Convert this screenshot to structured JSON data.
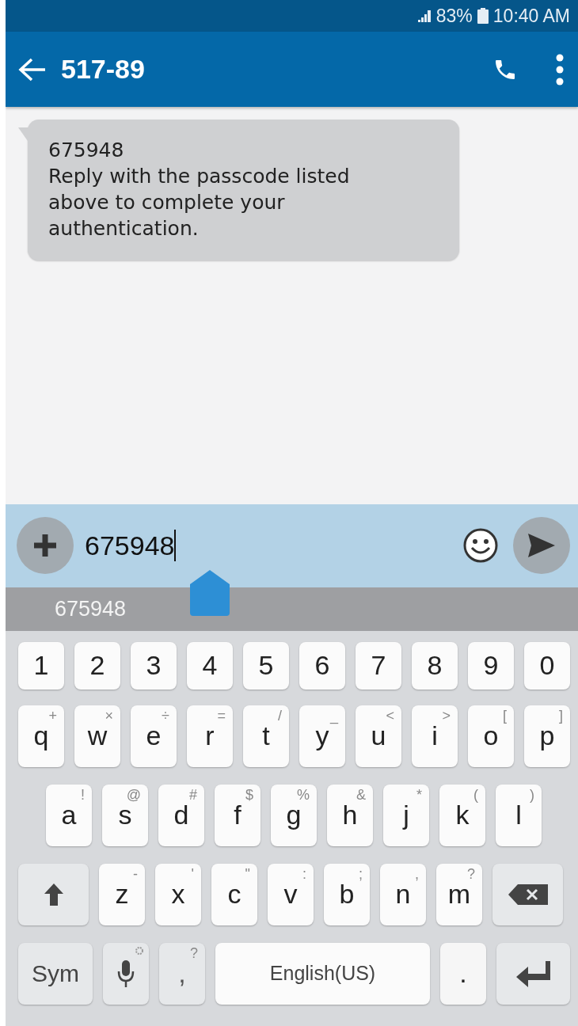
{
  "status_bar": {
    "battery": "83%",
    "time": "10:40 AM"
  },
  "app_bar": {
    "title": "517-89"
  },
  "messages": [
    {
      "code": "675948",
      "text": "Reply with the passcode listed above to complete your authentication."
    }
  ],
  "composer": {
    "value": "675948"
  },
  "suggestions": [
    "675948"
  ],
  "keyboard": {
    "rows": [
      {
        "keys": [
          {
            "kind": "char",
            "label": "1"
          },
          {
            "kind": "char",
            "label": "2"
          },
          {
            "kind": "char",
            "label": "3"
          },
          {
            "kind": "char",
            "label": "4"
          },
          {
            "kind": "char",
            "label": "5"
          },
          {
            "kind": "char",
            "label": "6"
          },
          {
            "kind": "char",
            "label": "7"
          },
          {
            "kind": "char",
            "label": "8"
          },
          {
            "kind": "char",
            "label": "9"
          },
          {
            "kind": "char",
            "label": "0"
          }
        ]
      },
      {
        "keys": [
          {
            "kind": "char",
            "label": "q",
            "hint": "+"
          },
          {
            "kind": "char",
            "label": "w",
            "hint": "×"
          },
          {
            "kind": "char",
            "label": "e",
            "hint": "÷"
          },
          {
            "kind": "char",
            "label": "r",
            "hint": "="
          },
          {
            "kind": "char",
            "label": "t",
            "hint": "/"
          },
          {
            "kind": "char",
            "label": "y",
            "hint": "_"
          },
          {
            "kind": "char",
            "label": "u",
            "hint": "<"
          },
          {
            "kind": "char",
            "label": "i",
            "hint": ">"
          },
          {
            "kind": "char",
            "label": "o",
            "hint": "["
          },
          {
            "kind": "char",
            "label": "p",
            "hint": "]"
          }
        ]
      },
      {
        "keys": [
          {
            "kind": "char",
            "label": "a",
            "hint": "!"
          },
          {
            "kind": "char",
            "label": "s",
            "hint": "@"
          },
          {
            "kind": "char",
            "label": "d",
            "hint": "#"
          },
          {
            "kind": "char",
            "label": "f",
            "hint": "$"
          },
          {
            "kind": "char",
            "label": "g",
            "hint": "%"
          },
          {
            "kind": "char",
            "label": "h",
            "hint": "&"
          },
          {
            "kind": "char",
            "label": "j",
            "hint": "*"
          },
          {
            "kind": "char",
            "label": "k",
            "hint": "("
          },
          {
            "kind": "char",
            "label": "l",
            "hint": ")"
          }
        ]
      },
      {
        "keys": [
          {
            "kind": "shift"
          },
          {
            "kind": "char",
            "label": "z",
            "hint": "-"
          },
          {
            "kind": "char",
            "label": "x",
            "hint": "'"
          },
          {
            "kind": "char",
            "label": "c",
            "hint": "\""
          },
          {
            "kind": "char",
            "label": "v",
            "hint": ":"
          },
          {
            "kind": "char",
            "label": "b",
            "hint": ";"
          },
          {
            "kind": "char",
            "label": "n",
            "hint": ","
          },
          {
            "kind": "char",
            "label": "m",
            "hint": "?"
          },
          {
            "kind": "backspace"
          }
        ]
      },
      {
        "keys": [
          {
            "kind": "sym",
            "label": "Sym"
          },
          {
            "kind": "mic"
          },
          {
            "kind": "comma",
            "label": ",",
            "hint": "?"
          },
          {
            "kind": "space",
            "label": "English(US)"
          },
          {
            "kind": "char",
            "label": "."
          },
          {
            "kind": "enter"
          }
        ]
      }
    ]
  }
}
